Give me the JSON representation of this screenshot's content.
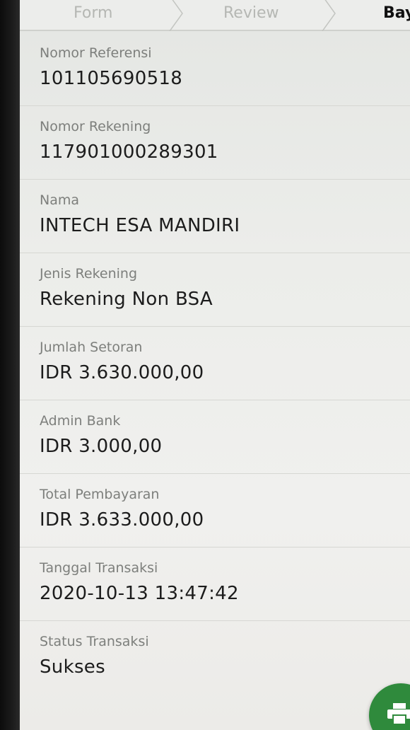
{
  "stepper": {
    "steps": [
      "Form",
      "Review",
      "Bay"
    ]
  },
  "details": [
    {
      "label": "Nomor Referensi",
      "value": "101105690518"
    },
    {
      "label": "Nomor Rekening",
      "value": "117901000289301"
    },
    {
      "label": "Nama",
      "value": "INTECH ESA MANDIRI"
    },
    {
      "label": "Jenis Rekening",
      "value": "Rekening Non BSA"
    },
    {
      "label": "Jumlah Setoran",
      "value": "IDR 3.630.000,00"
    },
    {
      "label": "Admin Bank",
      "value": "IDR 3.000,00"
    },
    {
      "label": "Total Pembayaran",
      "value": "IDR 3.633.000,00"
    },
    {
      "label": "Tanggal Transaksi",
      "value": "2020-10-13 13:47:42"
    },
    {
      "label": "Status Transaksi",
      "value": "Sukses"
    }
  ],
  "colors": {
    "accent": "#2f8a3c",
    "active_step": "#111111",
    "inactive_step": "#b5b7b3"
  },
  "fab": {
    "icon": "print-icon"
  }
}
